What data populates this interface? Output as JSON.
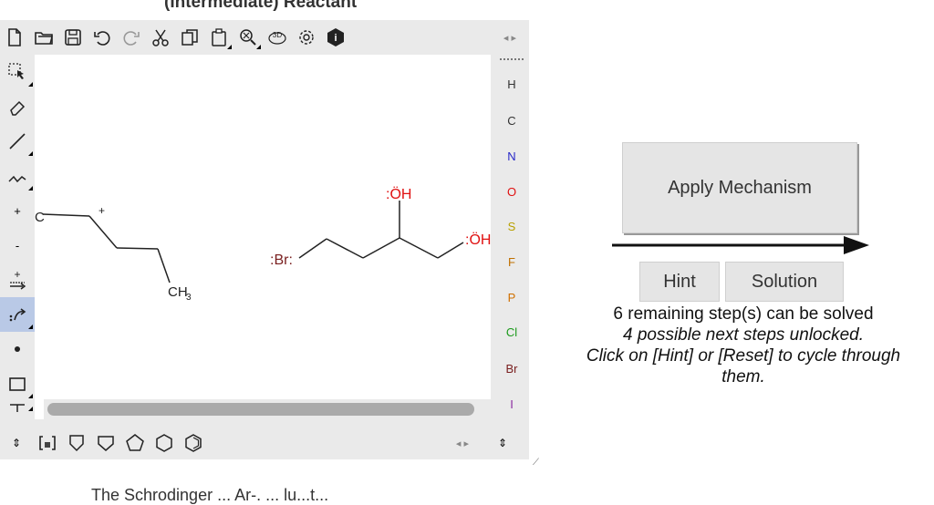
{
  "page_title": "(Intermediate) Reactant",
  "toolbar": {
    "top": [
      "new-icon",
      "open-icon",
      "save-icon",
      "undo-icon",
      "redo-icon",
      "cut-icon",
      "copy-icon",
      "paste-icon",
      "zoom-icon",
      "3d-icon",
      "settings-icon",
      "info-icon"
    ],
    "label_3d": "3D",
    "label_info": "i"
  },
  "left_tools": [
    {
      "name": "select-tool-icon"
    },
    {
      "name": "eraser-icon"
    },
    {
      "name": "bond-tool-icon"
    },
    {
      "name": "chain-tool-icon"
    },
    {
      "name": "positive-charge-icon",
      "text": "+"
    },
    {
      "name": "negative-charge-icon",
      "text": "-"
    },
    {
      "name": "reaction-arrow-icon"
    },
    {
      "name": "curved-arrow-icon"
    },
    {
      "name": "radical-dot-icon"
    },
    {
      "name": "rectangle-tool-icon"
    },
    {
      "name": "text-tool-icon"
    }
  ],
  "atoms": [
    {
      "symbol": "H",
      "color": "#333333"
    },
    {
      "symbol": "C",
      "color": "#333333"
    },
    {
      "symbol": "N",
      "color": "#2828c8"
    },
    {
      "symbol": "O",
      "color": "#e01010"
    },
    {
      "symbol": "S",
      "color": "#b8a000"
    },
    {
      "symbol": "F",
      "color": "#c07000"
    },
    {
      "symbol": "P",
      "color": "#d07000"
    },
    {
      "symbol": "Cl",
      "color": "#1a9a1a"
    },
    {
      "symbol": "Br",
      "color": "#7a2020"
    },
    {
      "symbol": "I",
      "color": "#8a2aa0"
    }
  ],
  "molecules": {
    "ch3_label": "CH",
    "ch3_sub": "3",
    "c_label": "C",
    "plus": "+",
    "oh1": ":ÖH",
    "oh2": ":ÖH",
    "br": ":Br:"
  },
  "mechanism": {
    "apply_label": "Apply Mechanism",
    "hint_label": "Hint",
    "solution_label": "Solution"
  },
  "status": {
    "line1": "6 remaining step(s) can be solved",
    "line2": "4 possible next steps unlocked.",
    "line3": "Click on [Hint] or [Reset] to cycle through them."
  },
  "footer_text": "The Schrodinger ... Ar-. ... lu...t..."
}
